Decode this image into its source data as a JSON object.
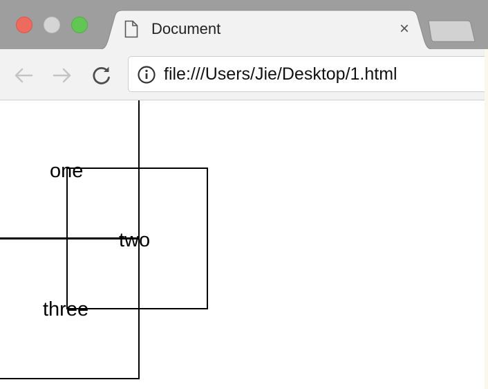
{
  "window": {
    "traffic_lights": [
      "close",
      "minimize",
      "zoom"
    ]
  },
  "tab": {
    "title": "Document",
    "icon": "document-icon",
    "close_glyph": "×"
  },
  "toolbar": {
    "back_icon": "back-arrow-icon",
    "forward_icon": "forward-arrow-icon",
    "reload_icon": "reload-icon"
  },
  "omnibox": {
    "info_icon": "info-icon",
    "url": "file:///Users/Jie/Desktop/1.html"
  },
  "page": {
    "labels": [
      "one",
      "two",
      "three"
    ]
  },
  "colors": {
    "titlebar": "#9e9e9e",
    "toolbar": "#f2f2f2",
    "close": "#ed6a5f",
    "zoom": "#61c654",
    "minimize": "#d5d5d5"
  }
}
